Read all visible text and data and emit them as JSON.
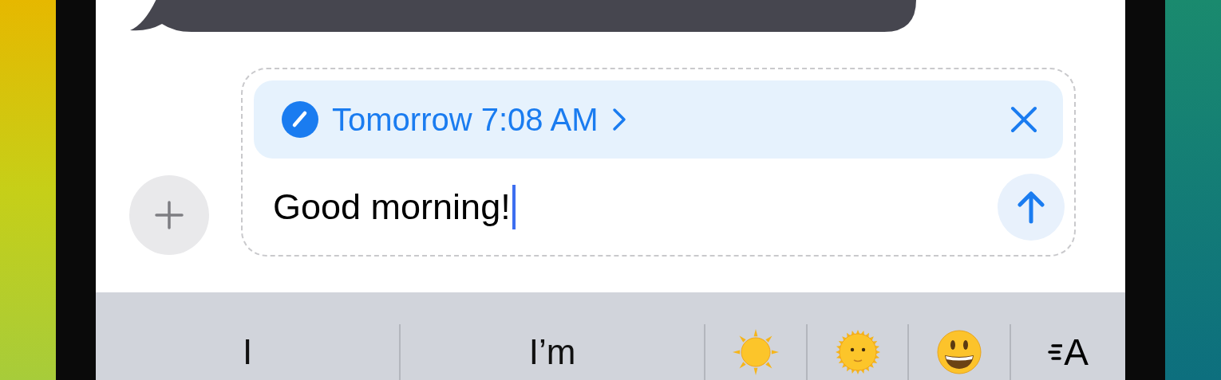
{
  "schedule": {
    "label": "Tomorrow 7:08 AM"
  },
  "composer": {
    "value": "Good morning!",
    "focused": true
  },
  "suggestions": [
    {
      "kind": "text",
      "label": "I"
    },
    {
      "kind": "text",
      "label": "I’m"
    },
    {
      "kind": "sun"
    },
    {
      "kind": "sun-face"
    },
    {
      "kind": "smiley"
    },
    {
      "kind": "format",
      "glyph": "A"
    }
  ]
}
